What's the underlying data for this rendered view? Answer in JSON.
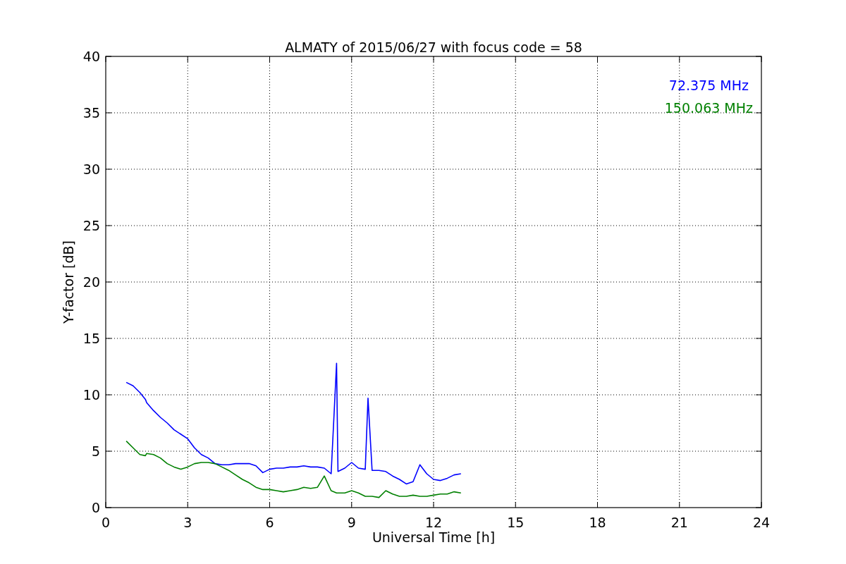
{
  "figure": {
    "chart_data": {
      "type": "line",
      "title": "ALMATY of 2015/06/27 with focus code = 58",
      "xlabel": "Universal Time [h]",
      "ylabel": "Y-factor [dB]",
      "x": [
        0.75,
        1,
        1.25,
        1.45,
        1.5,
        1.75,
        2,
        2.25,
        2.5,
        2.75,
        3,
        3.25,
        3.5,
        3.75,
        4,
        4.25,
        4.5,
        4.75,
        5,
        5.25,
        5.5,
        5.75,
        6,
        6.25,
        6.5,
        6.75,
        7,
        7.25,
        7.5,
        7.75,
        8,
        8.25,
        8.45,
        8.5,
        8.75,
        9,
        9.25,
        9.5,
        9.6,
        9.75,
        10,
        10.25,
        10.5,
        10.75,
        11,
        11.25,
        11.5,
        11.75,
        12,
        12.25,
        12.5,
        12.75,
        13
      ],
      "series": [
        {
          "name": "72.375 MHz",
          "color": "#0000ff",
          "values": [
            11.1,
            10.8,
            10.2,
            9.6,
            9.3,
            8.6,
            8.0,
            7.5,
            6.9,
            6.5,
            6.1,
            5.3,
            4.7,
            4.4,
            3.9,
            3.8,
            3.8,
            3.9,
            3.9,
            3.9,
            3.7,
            3.1,
            3.4,
            3.5,
            3.5,
            3.6,
            3.6,
            3.7,
            3.6,
            3.6,
            3.5,
            3.0,
            12.8,
            3.2,
            3.5,
            4.0,
            3.5,
            3.4,
            9.7,
            3.3,
            3.3,
            3.2,
            2.8,
            2.5,
            2.1,
            2.3,
            3.8,
            3.0,
            2.5,
            2.4,
            2.6,
            2.9,
            3.0
          ]
        },
        {
          "name": "150.063 MHz",
          "color": "#008000",
          "values": [
            5.9,
            5.3,
            4.7,
            4.6,
            4.8,
            4.7,
            4.4,
            3.9,
            3.6,
            3.4,
            3.6,
            3.9,
            4.0,
            4.0,
            3.9,
            3.6,
            3.3,
            2.9,
            2.5,
            2.2,
            1.8,
            1.6,
            1.6,
            1.5,
            1.4,
            1.5,
            1.6,
            1.8,
            1.7,
            1.8,
            2.8,
            1.5,
            1.3,
            1.3,
            1.3,
            1.5,
            1.3,
            1.0,
            1.0,
            1.0,
            0.9,
            1.5,
            1.2,
            1.0,
            1.0,
            1.1,
            1.0,
            1.0,
            1.1,
            1.2,
            1.2,
            1.4,
            1.3
          ]
        }
      ],
      "grid": true,
      "xlim": [
        0,
        24
      ],
      "ylim": [
        0,
        40
      ],
      "xticks": [
        0,
        3,
        6,
        9,
        12,
        15,
        18,
        21,
        24
      ],
      "yticks": [
        0,
        5,
        10,
        15,
        20,
        25,
        30,
        35,
        40
      ]
    }
  }
}
